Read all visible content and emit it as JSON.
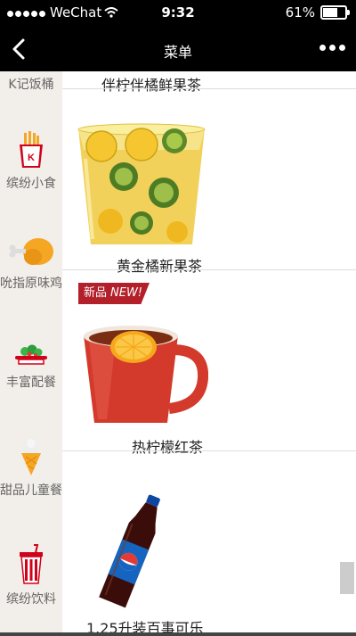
{
  "status": {
    "carrier": "WeChat",
    "time": "9:32",
    "battery": "61%",
    "battery_level": 0.61
  },
  "nav": {
    "title": "菜单",
    "back_icon": "chevron-left-icon",
    "more_icon": "more-dots-icon"
  },
  "sidebar": {
    "items": [
      {
        "label": "K记饭桶",
        "icon": ""
      },
      {
        "label": "缤纷小食",
        "icon": "fries-icon"
      },
      {
        "label": "吮指原味鸡",
        "icon": "chicken-drumstick-icon"
      },
      {
        "label": "丰富配餐",
        "icon": "salad-plate-icon"
      },
      {
        "label": "甜品儿童餐",
        "icon": "ice-cream-cone-icon"
      },
      {
        "label": "缤纷饮料",
        "icon": "drink-cup-icon"
      }
    ]
  },
  "products": [
    {
      "name": "伴柠伴橘鲜果茶"
    },
    {
      "name": "黄金橘新果茶"
    },
    {
      "name": "热柠檬红茶",
      "badge": "新品",
      "badge_new": "NEW!"
    },
    {
      "name": "1.25升装百事可乐"
    }
  ],
  "colors": {
    "accent": "#b3202a",
    "sidebar_bg": "#f2eee9",
    "nav_bg": "#000000"
  }
}
